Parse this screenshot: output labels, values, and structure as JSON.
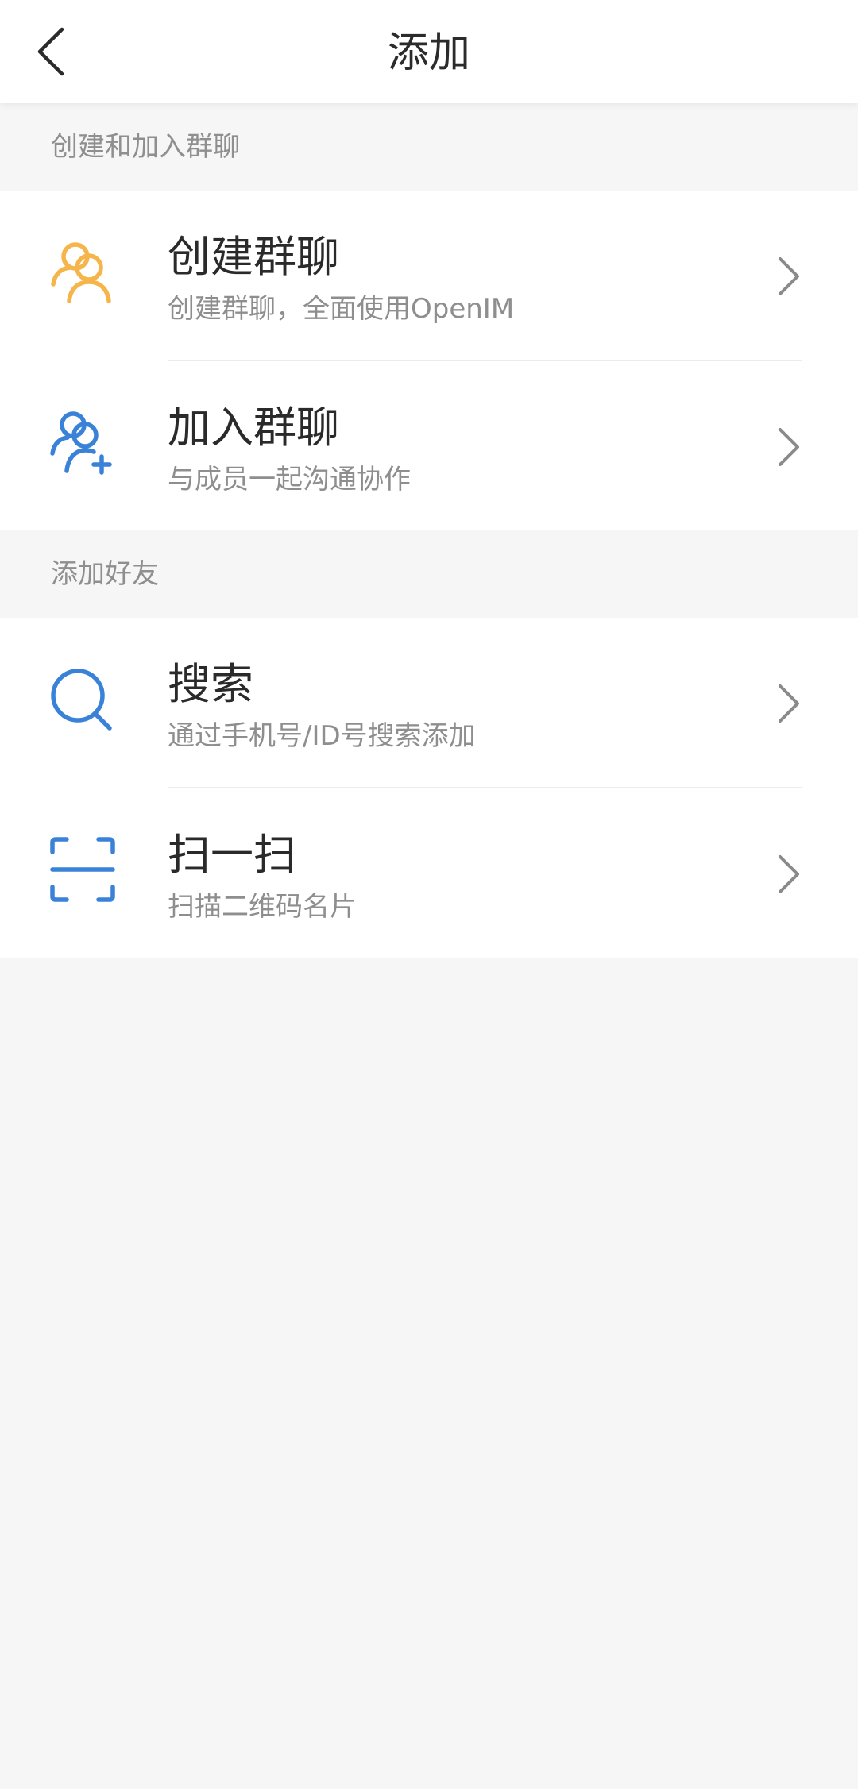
{
  "header": {
    "title": "添加",
    "back_icon": "chevron-left-icon"
  },
  "colors": {
    "group_icon": "#f5b54a",
    "blue_icon": "#3a82d8",
    "title_text": "#2a2a2a",
    "subtitle_text": "#8e8e8e",
    "page_background": "#f6f6f6"
  },
  "sections": [
    {
      "header": "创建和加入群聊",
      "items": [
        {
          "icon": "group-icon",
          "title": "创建群聊",
          "subtitle": "创建群聊，全面使用OpenIM"
        },
        {
          "icon": "add-group-member-icon",
          "title": "加入群聊",
          "subtitle": "与成员一起沟通协作"
        }
      ]
    },
    {
      "header": "添加好友",
      "items": [
        {
          "icon": "search-icon",
          "title": "搜索",
          "subtitle": "通过手机号/ID号搜索添加"
        },
        {
          "icon": "scan-icon",
          "title": "扫一扫",
          "subtitle": "扫描二维码名片"
        }
      ]
    }
  ]
}
